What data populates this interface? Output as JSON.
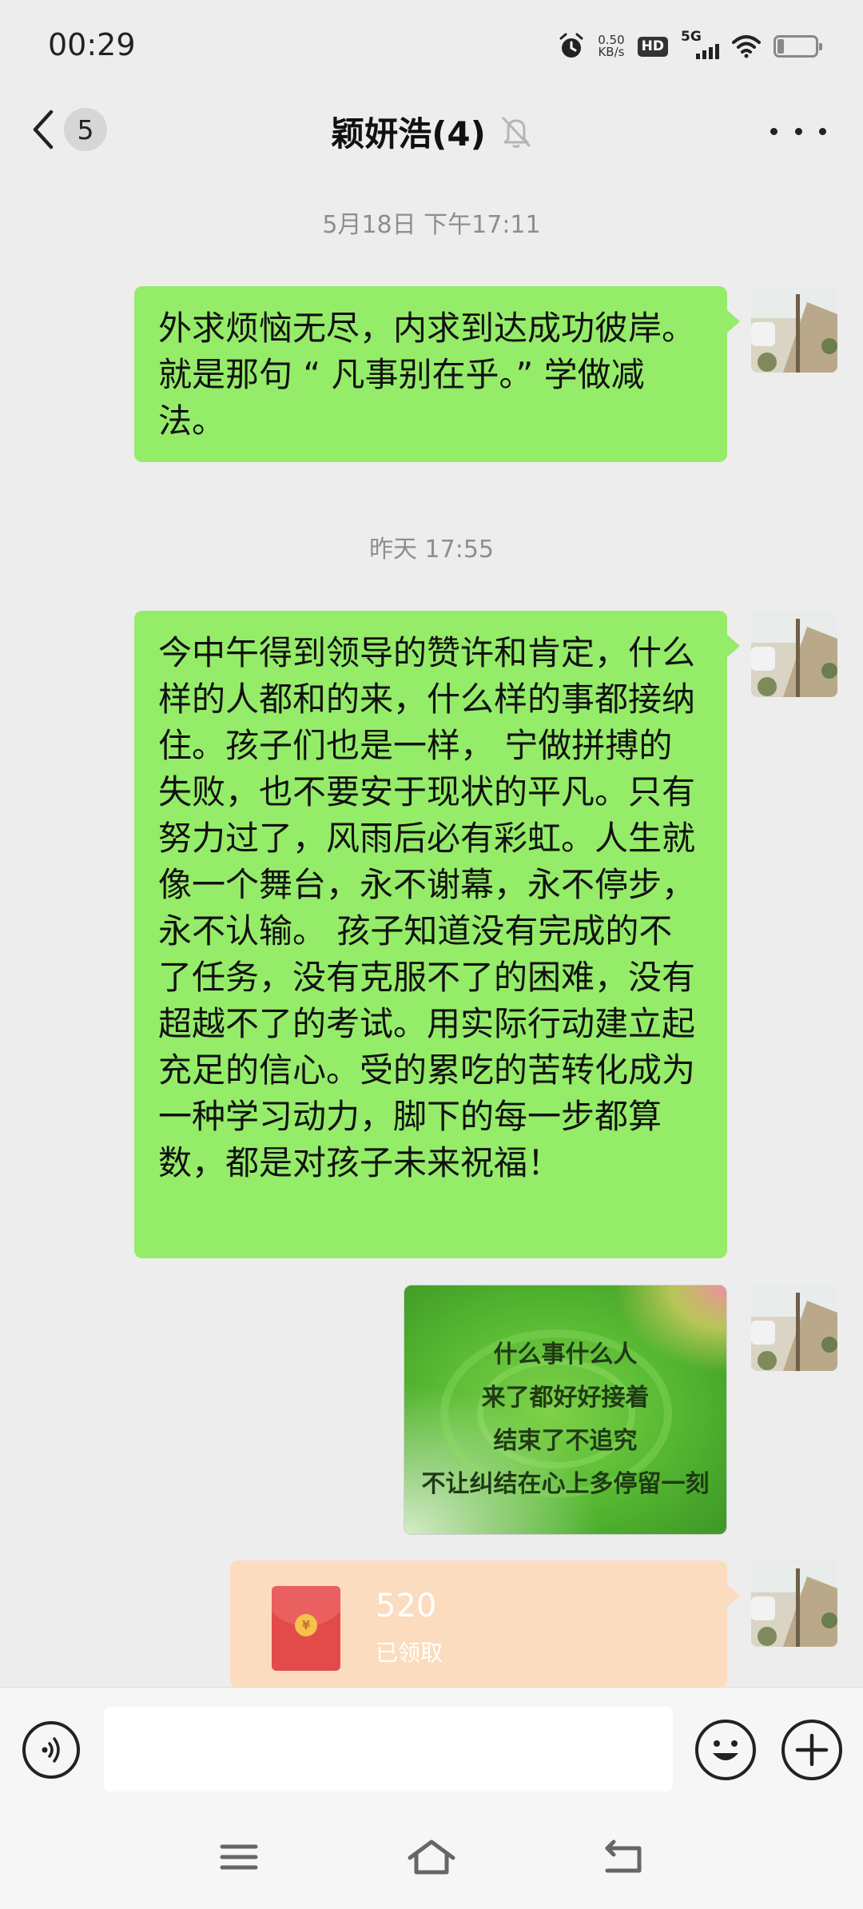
{
  "status_bar": {
    "time": "00:29",
    "net_speed_value": "0.50",
    "net_speed_unit": "KB/s",
    "hd_label": "HD",
    "network_label": "5G",
    "battery_level": 0.18,
    "icons": [
      "alarm-icon",
      "wifi-icon",
      "battery-icon"
    ]
  },
  "header": {
    "back_badge": "5",
    "title": "颖妍浩(4)",
    "icons": [
      "back-chevron-icon",
      "mute-bell-icon",
      "more-icon"
    ]
  },
  "messages": [
    {
      "type": "timestamp",
      "text": "5月18日 下午17:11"
    },
    {
      "type": "text",
      "sender": "self",
      "text": "外求烦恼无尽，内求到达成功彼岸。 就是那句 “ 凡事别在乎。” 学做减法。"
    },
    {
      "type": "timestamp",
      "text": "昨天 17:55"
    },
    {
      "type": "text",
      "sender": "self",
      "text": "今中午得到领导的赞许和肯定，什么样的人都和的来，什么样的事都接纳住。孩子们也是一样， 宁做拼搏的失败，也不要安于现状的平凡。只有努力过了，风雨后必有彩虹。人生就像一个舞台，永不谢幕，永不停步，永不认输。 孩子知道没有完成的不了任务，没有克服不了的困难，没有超越不了的考试。用实际行动建立起充足的信心。受的累吃的苦转化成为一种学习动力，脚下的每一步都算数，都是对孩子未来祝福！"
    },
    {
      "type": "image",
      "sender": "self",
      "lines": [
        "什么事什么人",
        "来了都好好接着",
        "结束了不追究",
        "不让纠结在心上多停留一刻"
      ]
    },
    {
      "type": "red_packet",
      "sender": "self",
      "amount": "520",
      "status": "已领取",
      "coin_symbol": "¥"
    }
  ],
  "input_bar": {
    "placeholder": "",
    "icons": [
      "voice-icon",
      "emoji-icon",
      "plus-icon"
    ]
  },
  "nav_bar": {
    "icons": [
      "menu-icon",
      "home-icon",
      "back-icon"
    ]
  },
  "colors": {
    "background": "#ededed",
    "self_bubble": "#95ec69",
    "red_packet_bg": "#fbdcbf",
    "red_packet_icon": "#e34b4b",
    "timestamp_text": "#8e8e8e"
  }
}
